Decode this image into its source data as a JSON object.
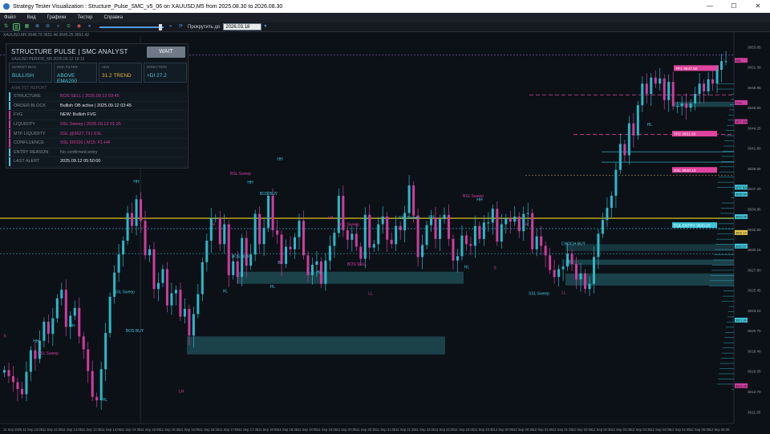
{
  "window": {
    "title": "Strategy Tester Visualization : Structure_Pulse_SMC_v5_06 on XAUUSD,M5 from 2025.08.30 to 2026.08.30",
    "controls": [
      "—",
      "☐",
      "✕"
    ]
  },
  "menu": [
    "Файл",
    "Вид",
    "Графики",
    "Тестер",
    "Справка"
  ],
  "toolbar": {
    "skip_to_label": "Прокрутить до",
    "date_value": "2026.03.18 00:00"
  },
  "symbol_line": "XAUUSD,M5  3648.79 3651.46 3645.25 3651.42",
  "panel": {
    "title": "STRUCTURE PULSE  |  SMC ANALYST",
    "subtitle": "XAUUSD  PERIOD_M5  2025.09.12 18:15",
    "wait_label": "WAIT",
    "cells": [
      {
        "k": "MARKET BIAS",
        "v": "BULLISH",
        "color": "#4ec8d8"
      },
      {
        "k": "EMA FILTER",
        "v": "ABOVE EMA200",
        "color": "#4ec8d8"
      },
      {
        "k": "ADX",
        "v": "31.2 TREND",
        "color": "#e8b43c"
      },
      {
        "k": "DIRECTION",
        "v": "+DI 27.2",
        "color": "#4ec8d8"
      }
    ],
    "report_head": "ANALYST REPORT",
    "rows": [
      {
        "k": "STRUCTURE",
        "v": "BOS SELL | 2025.09.12 03:45",
        "color": "#d03c9c",
        "bar": "#4ec8d8"
      },
      {
        "k": "ORDER BLOCK",
        "v": "Bullish OB active | 2025.09.12 03:45",
        "color": "#e4e8ec",
        "bar": "#4ec8d8"
      },
      {
        "k": "FVG",
        "v": "NEW: Bullish FVG",
        "color": "#e4e8ec",
        "bar": "#d03c9c"
      },
      {
        "k": "LIQUIDITY",
        "v": "SSL Sweep | 2025.09.12 01:25",
        "color": "#d03c9c",
        "bar": "#d03c9c"
      },
      {
        "k": "MTF LIQUIDITY",
        "v": "SSL @3627.73 | SSL",
        "color": "#d03c9c",
        "bar": "#d03c9c"
      },
      {
        "k": "CONFLUENCE",
        "v": "SSL 50/100 | M15: F1-H4",
        "color": "#d03c9c",
        "bar": "#d03c9c"
      },
      {
        "k": "ENTRY REASON",
        "v": "No confirmed entry",
        "color": "#7e8a96",
        "bar": "#4ec8d8"
      },
      {
        "k": "LAST ALERT",
        "v": "2025.09.12 05:50:00",
        "color": "#e4e8ec",
        "bar": "#4ec8d8"
      }
    ]
  },
  "chart_data": {
    "type": "candlestick",
    "symbol": "XAUUSD",
    "timeframe": "M5",
    "price_axis": [
      "3653.65",
      "3651.30",
      "3648.95",
      "3646.60",
      "3644.25",
      "3641.90",
      "3639.55",
      "3637.20",
      "3634.85",
      "3632.50",
      "3630.15",
      "3627.80",
      "3625.45",
      "3623.10",
      "3620.75",
      "3618.40",
      "3616.05",
      "3613.70",
      "3611.35"
    ],
    "time_axis": [
      "11 Sep 2025",
      "11 Sep 12:05",
      "11 Sep 12:35",
      "11 Sep 13:05",
      "11 Sep 13:35",
      "11 Sep 14:05",
      "11 Sep 14:35",
      "11 Sep 15:05",
      "11 Sep 15:35",
      "11 Sep 16:05",
      "11 Sep 16:35",
      "11 Sep 17:05",
      "11 Sep 17:35",
      "11 Sep 18:05",
      "11 Sep 18:35",
      "11 Sep 19:05",
      "11 Sep 19:35",
      "11 Sep 20:05",
      "11 Sep 20:35",
      "11 Sep 21:05",
      "11 Sep 21:35",
      "11 Sep 22:05",
      "11 Sep 22:35",
      "11 Sep 23:05",
      "11 Sep 23:35",
      "12 Sep 00:05",
      "12 Sep 00:35",
      "12 Sep 01:05",
      "12 Sep 01:35",
      "12 Sep 02:05",
      "12 Sep 02:35",
      "12 Sep 03:05",
      "12 Sep 03:35",
      "12 Sep 04:05",
      "12 Sep 04:35",
      "12 Sep 05:05",
      "12 Sep 05:35"
    ],
    "closes": [
      3616.2,
      3615.5,
      3614.8,
      3614.0,
      3613.4,
      3616.0,
      3618.5,
      3617.5,
      3619.6,
      3621.8,
      3620.4,
      3622.2,
      3624.5,
      3625.5,
      3621.2,
      3622.5,
      3623.4,
      3620.1,
      3618.6,
      3616.1,
      3613.1,
      3612.7,
      3616.3,
      3620.5,
      3624.7,
      3627.5,
      3629.6,
      3631.2,
      3634.4,
      3632.9,
      3636.0,
      3633.5,
      3629.5,
      3630.2,
      3625.6,
      3626.3,
      3627.9,
      3623.7,
      3625.1,
      3625.5,
      3622.4,
      3623.3,
      3620.2,
      3622.7,
      3625.0,
      3628.7,
      3631.2,
      3633.8,
      3633.8,
      3630.8,
      3633.1,
      3627.2,
      3628.8,
      3627.0,
      3631.5,
      3628.3,
      3629.6,
      3634.3,
      3630.8,
      3632.7,
      3636.4,
      3632.4,
      3631.9,
      3628.5,
      3630.5,
      3630.2,
      3631.6,
      3633.5,
      3629.5,
      3627.2,
      3628.4,
      3628.8,
      3626.2,
      3628.9,
      3630.6,
      3632.1,
      3636.4,
      3632.4,
      3631.3,
      3632.0,
      3630.5,
      3629.1,
      3634.2,
      3630.4,
      3630.8,
      3633.1,
      3634.0,
      3631.3,
      3630.8,
      3632.9,
      3632.4,
      3634.4,
      3637.6,
      3634.1,
      3629.3,
      3630.7,
      3633.0,
      3633.9,
      3631.4,
      3633.7,
      3634.2,
      3631.4,
      3628.9,
      3629.4,
      3631.8,
      3630.8,
      3630.6,
      3632.9,
      3631.4,
      3633.3,
      3633.3,
      3634.9,
      3631.1,
      3633.1,
      3633.8,
      3633.4,
      3634.0,
      3632.3,
      3634.3,
      3634.4,
      3630.2,
      3631.7,
      3630.6,
      3629.5,
      3627.8,
      3627.0,
      3627.9,
      3628.2,
      3629.7,
      3628.5,
      3626.7,
      3627.4,
      3625.6,
      3626.2,
      3629.3,
      3632.0,
      3633.6,
      3635.0,
      3636.4,
      3639.4,
      3642.4,
      3641.1,
      3644.8,
      3643.4,
      3646.9,
      3649.4,
      3648.2,
      3650.1,
      3649.4,
      3650.0,
      3647.5,
      3649.6,
      3646.8,
      3646.8,
      3647.1,
      3646.6,
      3647.1,
      3648.2,
      3649.4,
      3648.5,
      3649.9,
      3649.4,
      3651.0,
      3652.0,
      3652.0
    ],
    "levels": [
      {
        "label": "TP1 3647.50",
        "color": "#e0449c",
        "style": "dashed"
      },
      {
        "label": "TP2 3651.50",
        "color": "#e0449c",
        "style": "dashed"
      },
      {
        "label": "SSL 3640.12",
        "color": "#e0449c",
        "style": "dotted"
      },
      {
        "label": "BSL 3651.80",
        "color": "#b070e0",
        "style": "dotted"
      },
      {
        "label": "EQL ENTRY 3633.20",
        "color": "#3ec4d8",
        "style": "dotted"
      },
      {
        "label": "EMA200",
        "color": "#c8b41c",
        "style": "solid"
      }
    ],
    "right_tags": [
      {
        "text": "BSL",
        "color": "#d03c9c"
      },
      {
        "text": "FVG",
        "color": "#d03c9c"
      },
      {
        "text": "MTF SSL",
        "color": "#d03c9c"
      },
      {
        "text": "MTF BSL",
        "color": "#3ec4d8"
      },
      {
        "text": "3636.59",
        "color": "#3ec4d8"
      },
      {
        "text": "3633.98",
        "color": "#3ec4d8"
      },
      {
        "text": "3632.14",
        "color": "#e8c84a"
      },
      {
        "text": "3630.57",
        "color": "#3ec4d8"
      },
      {
        "text": "3621.99",
        "color": "#3ec4d8"
      },
      {
        "text": "3614.39",
        "color": "#d03c9c"
      }
    ],
    "annotations": [
      {
        "text": "HH",
        "color": "#3ec4d8"
      },
      {
        "text": "LH",
        "color": "#d03c9c"
      },
      {
        "text": "LL",
        "color": "#d03c9c"
      },
      {
        "text": "HL",
        "color": "#3ec4d8"
      },
      {
        "text": "BSL Sweep",
        "color": "#d03c9c"
      },
      {
        "text": "SSL Sweep",
        "color": "#3ec4d8"
      },
      {
        "text": "BOS BUY",
        "color": "#3ec4d8"
      },
      {
        "text": "BOS SELL",
        "color": "#d03c9c"
      },
      {
        "text": "CHOCH BUY",
        "color": "#3ec4d8"
      },
      {
        "text": "B",
        "color": "#3ec4d8"
      },
      {
        "text": "S",
        "color": "#d03c9c"
      }
    ]
  }
}
